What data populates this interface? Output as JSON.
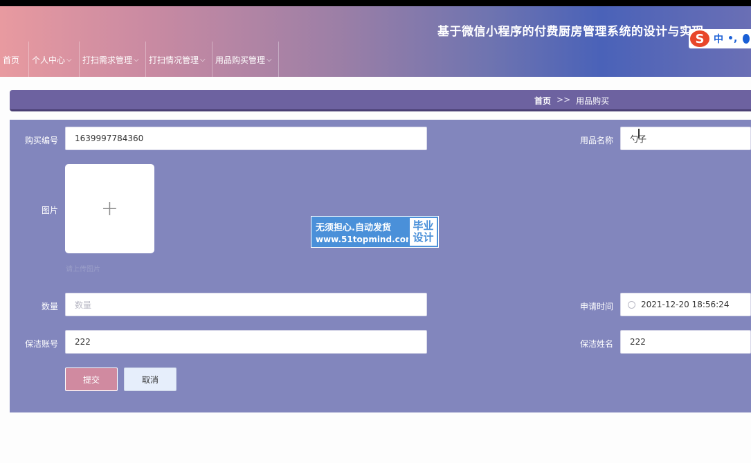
{
  "app": {
    "title": "基于微信小程序的付费厨房管理系统的设计与实现"
  },
  "ime": {
    "logo": "S",
    "mode": "中",
    "punct": "•,"
  },
  "nav": {
    "items": [
      {
        "label": "首页",
        "has_dropdown": false
      },
      {
        "label": "个人中心",
        "has_dropdown": true
      },
      {
        "label": "打扫需求管理",
        "has_dropdown": true
      },
      {
        "label": "打扫情况管理",
        "has_dropdown": true
      },
      {
        "label": "用品购买管理",
        "has_dropdown": true
      }
    ]
  },
  "breadcrumb": {
    "home": "首页",
    "separator": ">>",
    "current": "用品购买"
  },
  "form": {
    "purchase_no": {
      "label": "购买编号",
      "value": "1639997784360"
    },
    "item_name": {
      "label": "用品名称",
      "value": "勺子"
    },
    "image": {
      "label": "图片",
      "tip": "请上传图片"
    },
    "quantity": {
      "label": "数量",
      "value": "",
      "placeholder": "数量"
    },
    "apply_time": {
      "label": "申请时间",
      "value": "2021-12-20 18:56:24"
    },
    "cleaner_account": {
      "label": "保洁账号",
      "value": "222"
    },
    "cleaner_name": {
      "label": "保洁姓名",
      "value": "222"
    },
    "submit_label": "提交",
    "cancel_label": "取消"
  },
  "watermark": {
    "line1": "无须担心.自动发货",
    "line2": "www.51topmind.com",
    "badge_line1": "毕业",
    "badge_line2": "设计"
  },
  "colors": {
    "form_panel": "#8286bd",
    "breadcrumb_bar": "#6d62a0",
    "submit_button": "#d08aa0",
    "cancel_button": "#e6eefb"
  }
}
